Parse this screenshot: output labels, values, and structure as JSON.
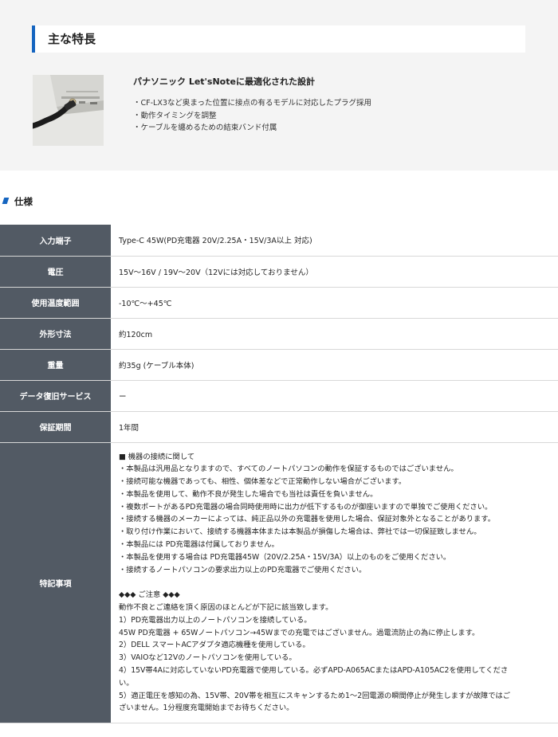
{
  "features": {
    "title": "主な特長",
    "heading": "パナソニック Let'sNoteに最適化された設計",
    "items": [
      "・CF-LX3など奥まった位置に接点の有るモデルに対応したプラグ採用",
      "・動作タイミングを調整",
      "・ケーブルを纏めるための結束バンド付属"
    ]
  },
  "spec": {
    "title": "仕様",
    "rows": [
      {
        "label": "入力端子",
        "value": "Type-C 45W(PD充電器 20V/2.25A・15V/3A以上 対応)"
      },
      {
        "label": "電圧",
        "value": "15V〜16V / 19V〜20V（12Vには対応しておりません）"
      },
      {
        "label": "使用温度範囲",
        "value": "-10℃〜+45℃"
      },
      {
        "label": "外形寸法",
        "value": "約120cm"
      },
      {
        "label": "重量",
        "value": "約35g (ケーブル本体)"
      },
      {
        "label": "データ復旧サービス",
        "value": "ー"
      },
      {
        "label": "保証期間",
        "value": "1年間"
      }
    ],
    "notes_label": "特記事項",
    "notes": [
      "■ 機器の接続に関して",
      "・本製品は汎用品となりますので、すべてのノートパソコンの動作を保証するものではございません。",
      "・接続可能な機器であっても、相性、個体差などで正常動作しない場合がございます。",
      "・本製品を使用して、動作不良が発生した場合でも当社は責任を負いません。",
      "・複数ポートがあるPD充電器の場合同時使用時に出力が低下するものが御座いますので単独でご使用ください。",
      "・接続する機器のメーカーによっては、純正品以外の充電器を使用した場合、保証対象外となることがあります。",
      "・取り付け作業において、接続する機器本体または本製品が損傷した場合は、弊社では一切保証致しません。",
      "・本製品には PD充電器は付属しておりません。",
      "・本製品を使用する場合は PD充電器45W（20V/2.25A・15V/3A）以上のものをご使用ください。",
      "・接続するノートパソコンの要求出力以上のPD充電器でご使用ください。",
      "",
      "◆◆◆ ご注意 ◆◆◆",
      "動作不良とご連絡を頂く原因のほとんどが下記に該当致します。",
      "1）PD充電器出力以上のノートパソコンを接続している。",
      "45W PD充電器 + 65Wノートパソコン→45Wまでの充電ではございません。過電流防止の為に停止します。",
      "2）DELL スマートACアダプタ適応機種を使用している。",
      "3）VAIOなど12Vのノートパソコンを使用している。",
      "4）15V帯4Aに対応していないPD充電器で使用している。必ずAPD-A065ACまたはAPD-A105AC2を使用してくださ",
      "い。",
      "5）適正電圧を感知の為、15V帯、20V帯を相互にスキャンするため1〜2回電源の瞬間停止が発生しますが故障ではご",
      "ざいません。1分程度充電開始までお待ちください。"
    ]
  }
}
